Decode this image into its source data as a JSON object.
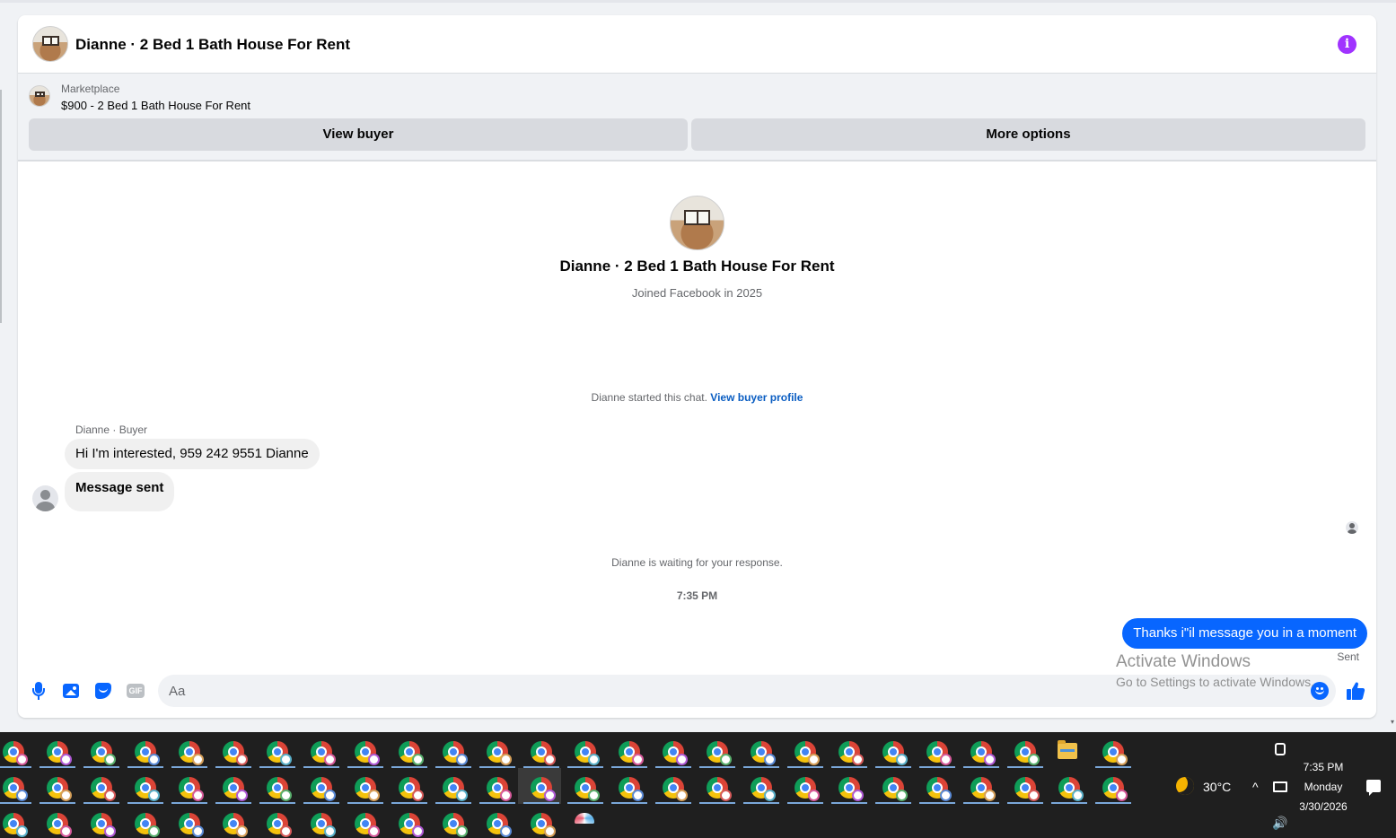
{
  "header": {
    "title": "Dianne · 2 Bed 1 Bath House For Rent",
    "info_icon": "info-icon",
    "info_glyph": "i",
    "accent_color": "#a033ff"
  },
  "marketplace": {
    "label": "Marketplace",
    "listing": "$900 - 2 Bed 1 Bath House For Rent",
    "view_buyer_label": "View buyer",
    "more_options_label": "More options"
  },
  "profile": {
    "name": "Dianne · 2 Bed 1 Bath House For Rent",
    "joined": "Joined Facebook in 2025"
  },
  "conversation": {
    "started_text": "Dianne started this chat.",
    "started_link": "View buyer profile",
    "sender_label": "Dianne · Buyer",
    "incoming": [
      "Hi I'm interested, 959 242 9551 Dianne",
      "Message sent"
    ],
    "waiting_text": "Dianne is waiting for your response.",
    "timestamp": "7:35 PM",
    "outgoing": "Thanks i\"il message you in a moment",
    "outgoing_status": "Sent",
    "outgoing_color": "#0866ff"
  },
  "composer": {
    "placeholder": "Aa",
    "value": "",
    "icons": [
      "mic-icon",
      "photo-icon",
      "sticker-icon",
      "gif-icon",
      "emoji-icon",
      "like-icon"
    ],
    "gif_label": "GIF"
  },
  "watermark": {
    "line1": "Activate Windows",
    "line2": "Go to Settings to activate Windows."
  },
  "taskbar": {
    "weather_temp": "30°C",
    "weather_icon": "moon-icon",
    "clock_time": "7:35 PM",
    "clock_day": "Monday",
    "clock_date": "3/30/2026",
    "chevron_glyph": "^",
    "volume_glyph": "🔊",
    "app_icon": "chrome-icon"
  }
}
